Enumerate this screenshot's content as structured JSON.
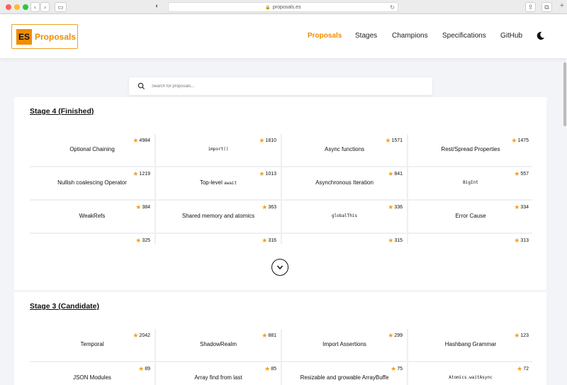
{
  "browser": {
    "url": "proposals.es"
  },
  "header": {
    "logo_badge": "ES",
    "logo_text": "Proposals",
    "nav": [
      "Proposals",
      "Stages",
      "Champions",
      "Specifications",
      "GitHub"
    ]
  },
  "search": {
    "placeholder": "Search for proposals..."
  },
  "stage4": {
    "title": "Stage 4 (Finished)",
    "cards": [
      {
        "title": "Optional Chaining",
        "stars": "4984",
        "code": false
      },
      {
        "title": "import()",
        "stars": "1810",
        "code": true
      },
      {
        "title": "Async functions",
        "stars": "1571",
        "code": false
      },
      {
        "title": "Rest/Spread Properties",
        "stars": "1475",
        "code": false
      },
      {
        "title": "Nullish coalescing Operator",
        "stars": "1219",
        "code": false
      },
      {
        "title": "Top-level ",
        "title_code": "await",
        "stars": "1013",
        "code": false
      },
      {
        "title": "Asynchronous Iteration",
        "stars": "841",
        "code": false
      },
      {
        "title": "BigInt",
        "stars": "557",
        "code": true
      },
      {
        "title": "WeakRefs",
        "stars": "384",
        "code": false
      },
      {
        "title": "Shared memory and atomics",
        "stars": "363",
        "code": false
      },
      {
        "title": "globalThis",
        "stars": "336",
        "code": true
      },
      {
        "title": "Error Cause",
        "stars": "334",
        "code": false
      },
      {
        "title": "",
        "stars": "325",
        "code": false
      },
      {
        "title": "",
        "stars": "316",
        "code": false
      },
      {
        "title": "",
        "stars": "315",
        "code": false
      },
      {
        "title": "",
        "stars": "313",
        "code": false
      }
    ]
  },
  "stage3": {
    "title": "Stage 3 (Candidate)",
    "cards": [
      {
        "title": "Temporal",
        "stars": "2042",
        "code": false
      },
      {
        "title": "ShadowRealm",
        "stars": "881",
        "code": false
      },
      {
        "title": "Import Assertions",
        "stars": "299",
        "code": false
      },
      {
        "title": "Hashbang Grammar",
        "stars": "123",
        "code": false
      },
      {
        "title": "JSON Modules",
        "stars": "89",
        "code": false
      },
      {
        "title": "Array find from last",
        "stars": "85",
        "code": false
      },
      {
        "title": "Resizable and growable ArrayBuffe",
        "stars": "75",
        "code": false
      },
      {
        "title": "Atomics.waitAsync",
        "stars": "72",
        "code": true
      }
    ]
  },
  "colors": {
    "accent": "#f08c00",
    "star": "#f0a020"
  }
}
